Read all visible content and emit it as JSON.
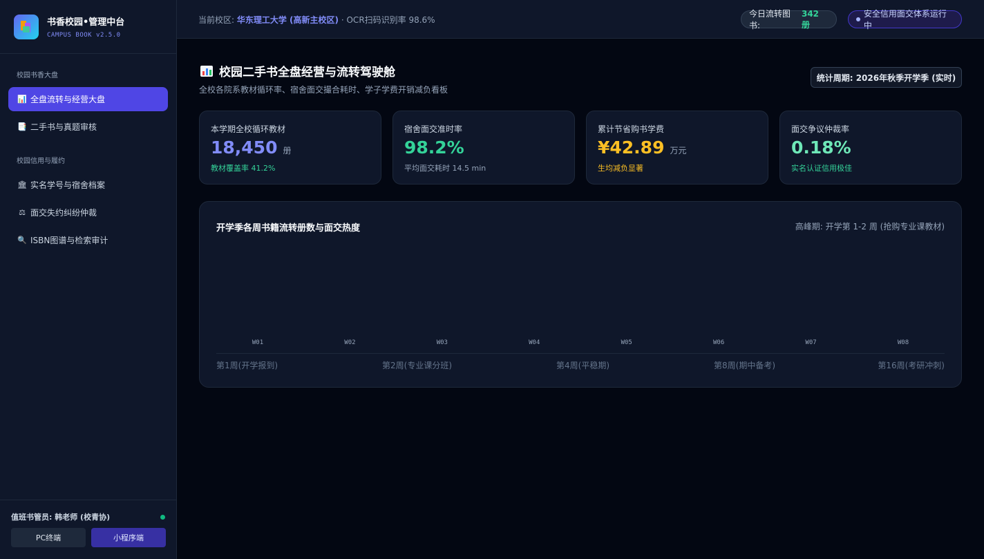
{
  "sidebar": {
    "brand_title": "书香校园•管理中台",
    "brand_sub": "CAMPUS BOOK v2.5.0",
    "sections": [
      {
        "title": "校园书香大盘",
        "items": [
          {
            "icon": "📊",
            "label": "全盘流转与经营大盘",
            "active": true
          },
          {
            "icon": "📑",
            "label": "二手书与真题审核",
            "active": false
          }
        ]
      },
      {
        "title": "校园信用与履约",
        "items": [
          {
            "icon": "🏛",
            "label": "实名学号与宿舍档案",
            "active": false
          },
          {
            "icon": "⚖",
            "label": "面交失约纠纷仲裁",
            "active": false
          },
          {
            "icon": "🔍",
            "label": "ISBN图谱与检索审计",
            "active": false
          }
        ]
      }
    ],
    "operator": "值班书管员: 韩老师 (校青协)",
    "btn_pc": "PC终端",
    "btn_mini": "小程序端"
  },
  "topbar": {
    "campus_prefix": "当前校区:",
    "campus_name": "华东理工大学 (高新主校区)",
    "ocr_text": "· OCR扫码识别率 98.6%",
    "today_label": "今日流转图书:",
    "today_value": "342 册",
    "secure_text": "安全信用面交体系运行中"
  },
  "header": {
    "title": "校园二手书全盘经营与流转驾驶舱",
    "subtitle": "全校各院系教材循环率、宿舍面交撮合耗时、学子学费开销减负看板",
    "period": "统计周期: 2026年秋季开学季 (实时)"
  },
  "kpis": [
    {
      "label": "本学期全校循环教材",
      "value": "18,450",
      "unit": "册",
      "note": "教材覆盖率 41.2%",
      "value_color": "#818cf8",
      "note_color": "#34d399"
    },
    {
      "label": "宿舍面交准时率",
      "value": "98.2%",
      "unit": "",
      "note": "平均面交耗时 14.5 min",
      "value_color": "#34d399",
      "note_color": "#94a3b8"
    },
    {
      "label": "累计节省购书学费",
      "value": "¥42.89",
      "unit": "万元",
      "note": "生均减负显著",
      "value_color": "#fbbf24",
      "note_color": "#fbbf24"
    },
    {
      "label": "面交争议仲裁率",
      "value": "0.18%",
      "unit": "",
      "note": "实名认证信用极佳",
      "value_color": "#6ee7b7",
      "note_color": "#34d399"
    }
  ],
  "chart": {
    "title": "开学季各周书籍流转册数与面交热度",
    "peak_note": "高峰期: 开学第 1-2 周 (抢购专业课教材)",
    "phases": [
      "第1周(开学报到)",
      "第2周(专业课分班)",
      "第4周(平稳期)",
      "第8周(期中备考)",
      "第16周(考研冲刺)"
    ]
  },
  "chart_data": {
    "type": "bar",
    "categories": [
      "W01",
      "W02",
      "W03",
      "W04",
      "W05",
      "W06",
      "W07",
      "W08"
    ],
    "values": [
      0,
      0,
      0,
      0,
      0,
      0,
      0,
      0
    ],
    "title": "开学季各周书籍流转册数与面交热度",
    "xlabel": "",
    "ylabel": ""
  }
}
